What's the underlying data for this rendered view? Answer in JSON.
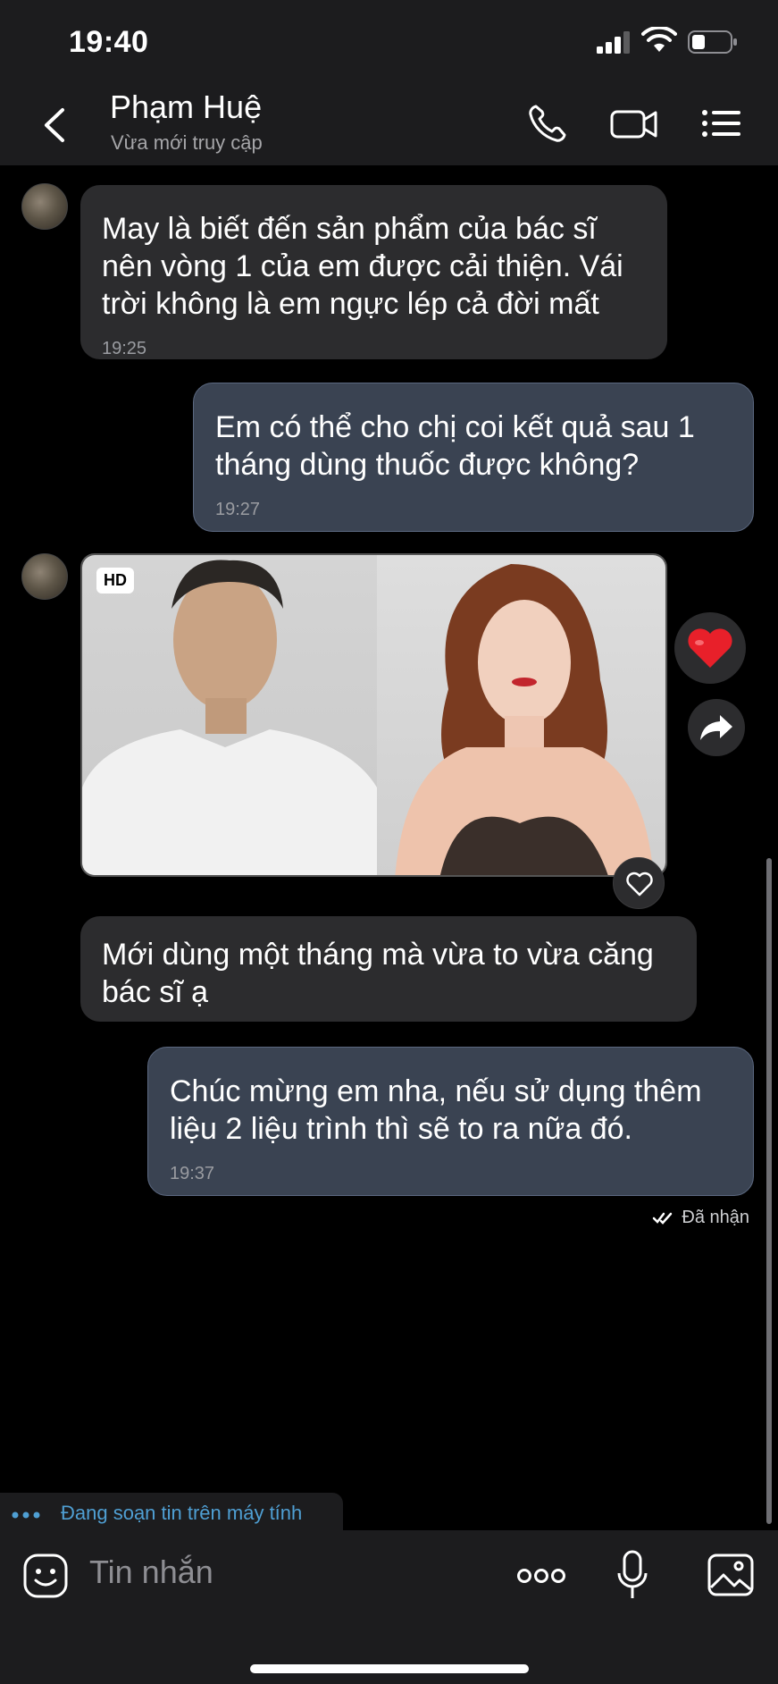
{
  "status_bar": {
    "time": "19:40"
  },
  "header": {
    "contact_name": "Phạm Huệ",
    "contact_status": "Vừa mới truy cập"
  },
  "messages": [
    {
      "direction": "incoming",
      "text": "May là biết đến sản phẩm của bác sĩ\nnên vòng 1 của em được cải thiện. Vái\ntrời không là em ngực lép cả đời mất",
      "time": "19:25"
    },
    {
      "direction": "outgoing",
      "text": "Em có thể cho chị  coi kết quả sau 1\ntháng dùng thuốc được không?",
      "time": "19:27"
    },
    {
      "direction": "incoming",
      "type": "image",
      "badge": "HD"
    },
    {
      "direction": "incoming",
      "text": "Mới dùng một tháng mà vừa to vừa căng\nbác sĩ ạ"
    },
    {
      "direction": "outgoing",
      "text": "Chúc mừng em nha, nếu sử dụng thêm\nliệu 2 liệu trình thì sẽ to ra nữa đó.",
      "time": "19:37"
    }
  ],
  "delivery_status": "Đã nhận",
  "typing_indicator": "Đang soạn tin trên máy tính",
  "composer": {
    "placeholder": "Tin nhắn"
  },
  "colors": {
    "accent": "#4f9fd3",
    "outgoing_bubble": "#3a4352",
    "incoming_bubble": "#2c2c2e",
    "reaction_heart": "#e8202a"
  },
  "icons": [
    "back-icon",
    "phone-icon",
    "video-icon",
    "menu-list-icon",
    "heart-reaction-icon",
    "share-icon",
    "heart-outline-icon",
    "check-double-icon",
    "sticker-icon",
    "more-icon",
    "microphone-icon",
    "image-icon"
  ]
}
